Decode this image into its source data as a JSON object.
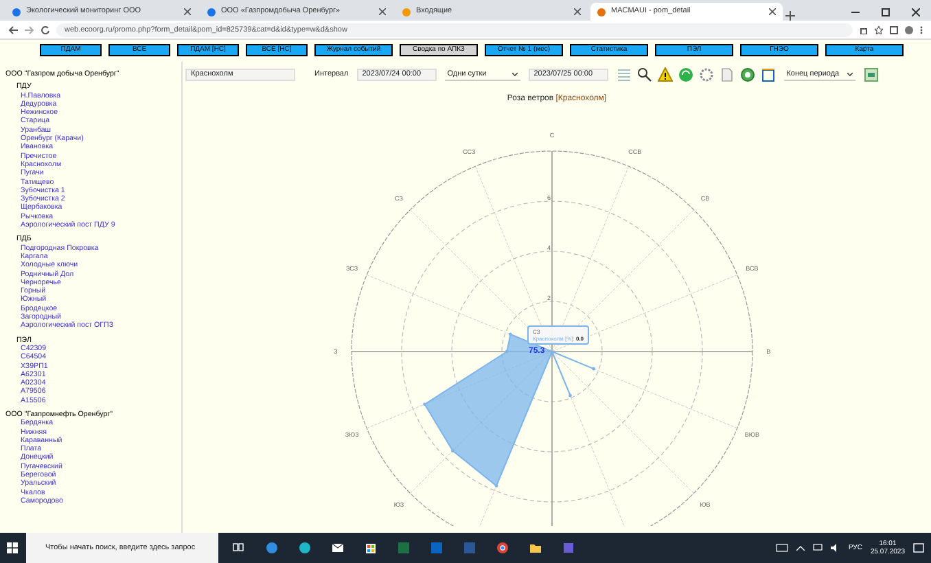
{
  "browser": {
    "tabs": [
      {
        "title": "Экологический мониторинг ООО",
        "selected": false
      },
      {
        "title": "ООО «Газпромдобыча Оренбург»",
        "selected": false
      },
      {
        "title": "Входящие",
        "selected": false
      },
      {
        "title": "MACMAUI - pom_detail",
        "selected": true
      }
    ],
    "url": "web.ecoorg.ru/promo.php?form_detail&pom_id=825739&cat=d&id&type=w&d&show"
  },
  "nav_buttons": [
    {
      "label": "ПДАМ",
      "selected": false
    },
    {
      "label": "ВСЕ",
      "selected": false
    },
    {
      "label": "ПДАМ [НС]",
      "selected": false
    },
    {
      "label": "ВСЕ [НС]",
      "selected": false
    },
    {
      "label": "Журнал событий",
      "selected": false
    },
    {
      "label": "Сводка по АПКЗ",
      "selected": true
    },
    {
      "label": "Отчет № 1 (мес)",
      "selected": false
    },
    {
      "label": "Статистика",
      "selected": false
    },
    {
      "label": "ПЭЛ",
      "selected": false
    },
    {
      "label": "ГНЭО",
      "selected": false
    },
    {
      "label": "Карта",
      "selected": false
    }
  ],
  "sidebar": [
    {
      "title": "ООО \"Газпром добыча Оренбург\"",
      "children": [
        {
          "title": "ПДУ",
          "children": [
            {
              "label": "Н.Павловка"
            },
            {
              "label": "Дедуровка"
            },
            {
              "label": "Нежинское"
            },
            {
              "label": "Старица"
            },
            {
              "label": "Уранбаш"
            },
            {
              "label": "Оренбург (Карачи)"
            },
            {
              "label": "Ивановка"
            },
            {
              "label": "Пречистое"
            },
            {
              "label": "Краснохолм"
            },
            {
              "label": "Пугачи"
            },
            {
              "label": "Татищево"
            },
            {
              "label": "Зубочистка 1"
            },
            {
              "label": "Зубочистка 2"
            },
            {
              "label": "Щербаковка"
            },
            {
              "label": "Рычковка"
            },
            {
              "label": "Аэрологический пост ПДУ 9"
            }
          ]
        },
        {
          "title": "ПДБ",
          "children": [
            {
              "label": "Подгородная Покровка"
            },
            {
              "label": "Каргала"
            },
            {
              "label": "Холодные ключи"
            },
            {
              "label": "Родничный Дол"
            },
            {
              "label": "Черноречье"
            },
            {
              "label": "Горный"
            },
            {
              "label": "Южный"
            },
            {
              "label": "Бродецкое"
            },
            {
              "label": "Загородный"
            },
            {
              "label": "Аэрологический пост ОГПЗ"
            }
          ]
        },
        {
          "title": "ПЭЛ",
          "children": [
            {
              "label": "С42309"
            },
            {
              "label": "С64504"
            },
            {
              "label": "ХЗ9РП1"
            },
            {
              "label": "А62301"
            },
            {
              "label": "А02304"
            },
            {
              "label": "А79506"
            },
            {
              "label": "А15506"
            }
          ]
        }
      ]
    },
    {
      "title": "ООО \"Газпромнефть Оренбург\"",
      "children": [
        {
          "children": [
            {
              "label": "Бердянка"
            },
            {
              "label": "Нижняя"
            },
            {
              "label": "Караванный"
            },
            {
              "label": "Плата"
            },
            {
              "label": "Донецкий"
            },
            {
              "label": "Пугачевский"
            },
            {
              "label": "Береговой"
            },
            {
              "label": "Уральский"
            },
            {
              "label": "Чкалов"
            },
            {
              "label": "Самородово"
            }
          ]
        }
      ]
    }
  ],
  "toolbar": {
    "station": "Краснохолм",
    "interval_label": "Интервал",
    "start": "2023/07/24 00:00",
    "period": "Одни сутки",
    "end": "2023/07/25 00:00",
    "mode": "Конец периода"
  },
  "chart": {
    "title": "Роза ветров",
    "station": "[Краснохолм]",
    "calm_label": "75.3",
    "tooltip": {
      "direction": "СЗ",
      "series": "Краснохолм [%]:",
      "value": "0.0"
    },
    "directions": [
      "ЮЗ",
      "ЗЮЗ",
      "З",
      "ЗСЗ",
      "СЗ",
      "ССЗ",
      "С",
      "ССВ",
      "СВ",
      "ВСВ",
      "В",
      "ВЮВ",
      "ЮВ"
    ],
    "radial_ticks": [
      "6",
      "4",
      "2"
    ]
  },
  "taskbar": {
    "search_placeholder": "Чтобы начать поиск, введите здесь запрос",
    "language": "РУС",
    "time": "16:01",
    "date": "25.07.2023"
  }
}
